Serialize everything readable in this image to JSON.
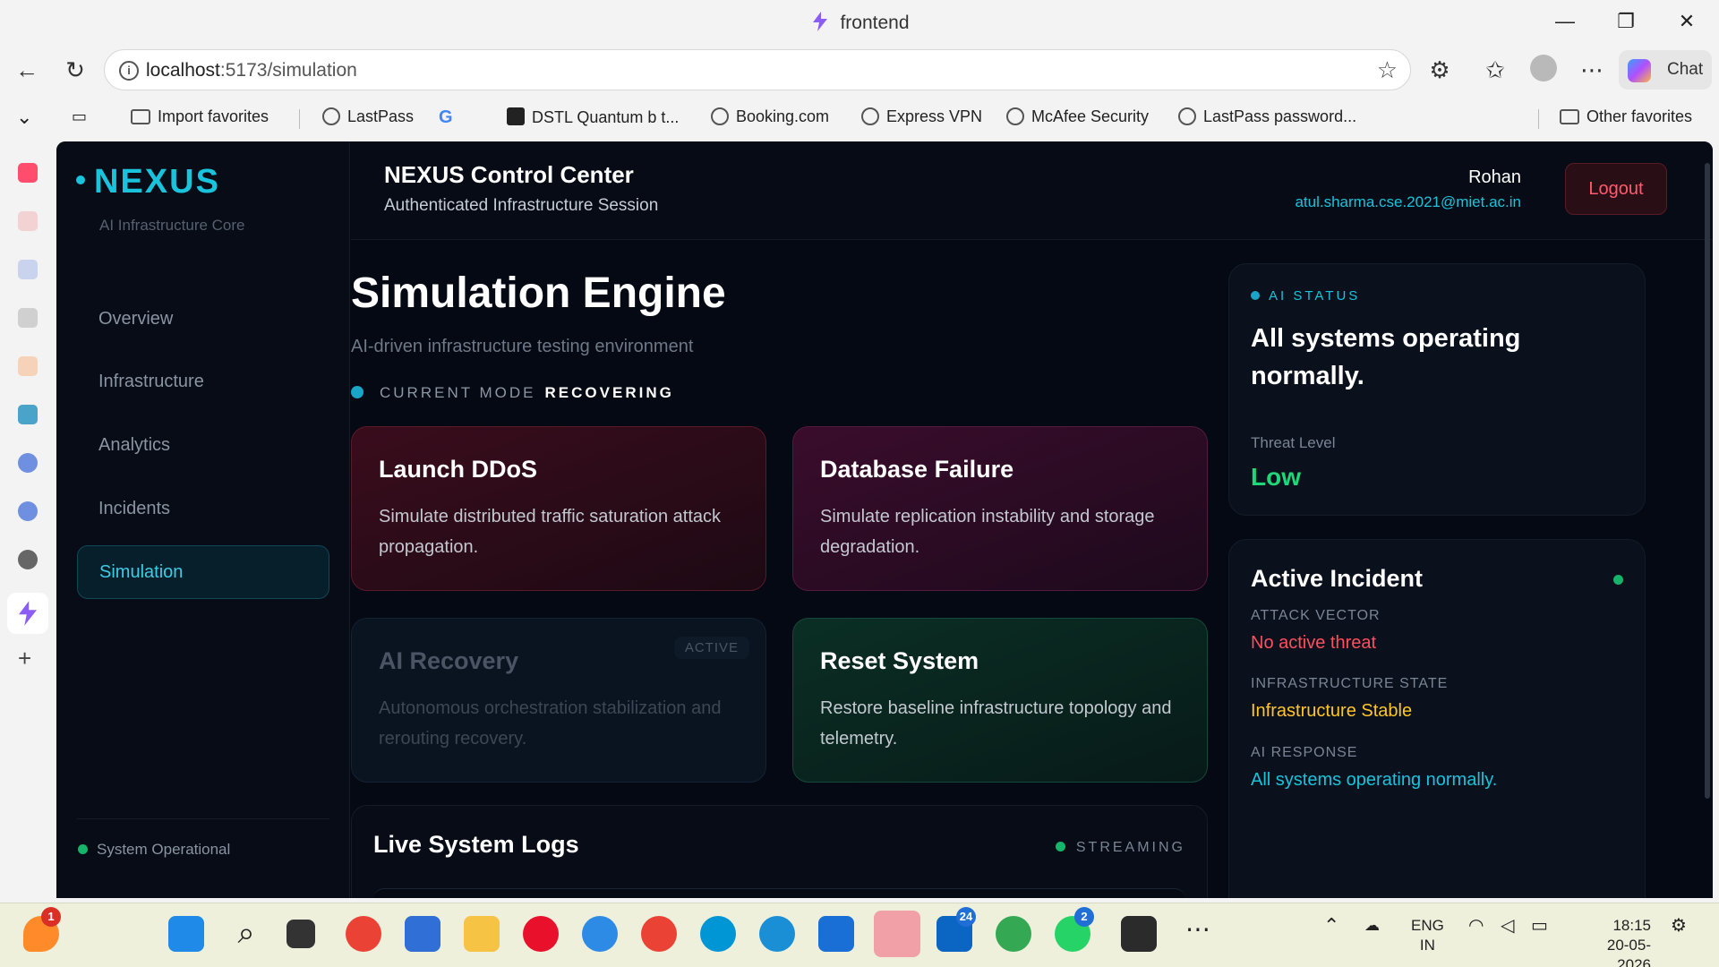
{
  "window": {
    "title": "frontend",
    "controls": [
      "minimize",
      "restore",
      "close"
    ]
  },
  "browser": {
    "url_host": "localhost",
    "url_path": ":5173/simulation",
    "chat_label": "Chat",
    "favorites": [
      {
        "label": "Import favorites",
        "icon": "import-icon"
      },
      {
        "label": "LastPass",
        "icon": "globe-icon"
      },
      {
        "label": "",
        "icon": "google-icon"
      },
      {
        "label": "DSTL Quantum b t...",
        "icon": "dstl-icon"
      },
      {
        "label": "Booking.com",
        "icon": "globe-icon"
      },
      {
        "label": "Express VPN",
        "icon": "globe-icon"
      },
      {
        "label": "McAfee Security",
        "icon": "globe-icon"
      },
      {
        "label": "LastPass password...",
        "icon": "globe-icon"
      }
    ],
    "other_favorites": "Other favorites"
  },
  "sidebar": {
    "brand": "NEXUS",
    "brand_sub": "AI Infrastructure Core",
    "items": [
      {
        "label": "Overview"
      },
      {
        "label": "Infrastructure"
      },
      {
        "label": "Analytics"
      },
      {
        "label": "Incidents"
      },
      {
        "label": "Simulation",
        "active": true
      }
    ],
    "status": "System Operational"
  },
  "header": {
    "title": "NEXUS Control Center",
    "subtitle": "Authenticated Infrastructure Session",
    "user_name": "Rohan",
    "user_email": "atul.sharma.cse.2021@miet.ac.in",
    "logout": "Logout"
  },
  "main": {
    "title": "Simulation Engine",
    "subtitle": "AI-driven infrastructure testing environment",
    "mode_label": "CURRENT MODE",
    "mode_value": "RECOVERING",
    "cards": [
      {
        "title": "Launch DDoS",
        "desc": "Simulate distributed traffic saturation attack propagation."
      },
      {
        "title": "Database Failure",
        "desc": "Simulate replication instability and storage degradation."
      },
      {
        "title": "AI Recovery",
        "desc": "Autonomous orchestration stabilization and rerouting recovery.",
        "badge": "ACTIVE",
        "disabled": true
      },
      {
        "title": "Reset System",
        "desc": "Restore baseline infrastructure topology and telemetry."
      }
    ],
    "logs_title": "Live System Logs",
    "logs_status": "STREAMING"
  },
  "ai_status": {
    "tag": "AI STATUS",
    "message": "All systems operating normally.",
    "threat_label": "Threat Level",
    "threat_value": "Low"
  },
  "incident": {
    "title": "Active Incident",
    "attack_vector_label": "ATTACK VECTOR",
    "attack_vector_value": "No active threat",
    "infra_state_label": "INFRASTRUCTURE STATE",
    "infra_state_value": "Infrastructure Stable",
    "ai_response_label": "AI RESPONSE",
    "ai_response_value": "All systems operating normally."
  },
  "colors": {
    "accent": "#19c3dc",
    "danger": "#ff5a6e",
    "success": "#1fd67a",
    "warning": "#ffc629"
  },
  "taskbar": {
    "notification_badge": "1",
    "linkedin_badge": "24",
    "whatsapp_badge": "2",
    "language": "ENG",
    "region": "IN",
    "time": "18:15",
    "date": "20-05-2026"
  }
}
